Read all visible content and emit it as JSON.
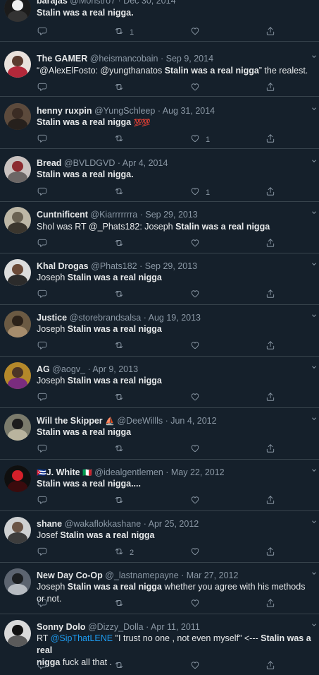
{
  "tweets": [
    {
      "name": "barajas",
      "handle": "@M0nstro7",
      "date": "Dec 30, 2014",
      "avatar_colors": [
        "#1b1b1b",
        "#f0f0f0",
        "#333"
      ],
      "text": [
        {
          "t": "Stalin was a real nigga.",
          "b": true
        }
      ],
      "counts": {
        "reply": "",
        "retweet": "1",
        "like": "",
        "share": ""
      }
    },
    {
      "name": "The GAMER",
      "handle": "@heismancobain",
      "date": "Sep 9, 2014",
      "avatar_colors": [
        "#e9e1dc",
        "#5a3a2e",
        "#b3283a"
      ],
      "text": [
        {
          "t": "“@AlexElFosto: @yungthanatos ",
          "b": false
        },
        {
          "t": "Stalin was a real nigga",
          "b": true
        },
        {
          "t": "” the realest.",
          "b": false
        }
      ],
      "counts": {
        "reply": "",
        "retweet": "",
        "like": "",
        "share": ""
      }
    },
    {
      "name": "henny ruxpin",
      "handle": "@YungSchleep",
      "date": "Aug 31, 2014",
      "avatar_colors": [
        "#5c4a3c",
        "#3b2c24",
        "#26201c"
      ],
      "text": [
        {
          "t": "Stalin was a real nigga ",
          "b": true
        }
      ],
      "emoji": "💯💯",
      "counts": {
        "reply": "",
        "retweet": "",
        "like": "1",
        "share": ""
      }
    },
    {
      "name": "Bread",
      "handle": "@BVLDGVD",
      "date": "Apr 4, 2014",
      "avatar_colors": [
        "#c9c2c0",
        "#8c2b30",
        "#6c6766"
      ],
      "text": [
        {
          "t": "Stalin was a real nigga.",
          "b": true
        }
      ],
      "counts": {
        "reply": "",
        "retweet": "",
        "like": "1",
        "share": ""
      }
    },
    {
      "name": "Cuntnificent",
      "handle": "@Kiarrrrrrra",
      "date": "Sep 29, 2013",
      "avatar_colors": [
        "#bdb7a6",
        "#6a6253",
        "#3b362e"
      ],
      "text": [
        {
          "t": "Shol was RT @_Phats182: Joseph ",
          "b": false
        },
        {
          "t": "Stalin was a real nigga",
          "b": true
        }
      ],
      "counts": {
        "reply": "",
        "retweet": "",
        "like": "",
        "share": ""
      }
    },
    {
      "name": "Khal Drogas",
      "handle": "@Phats182",
      "date": "Sep 29, 2013",
      "avatar_colors": [
        "#dcdcdc",
        "#6b4a38",
        "#2b2b2b"
      ],
      "text": [
        {
          "t": "Joseph ",
          "b": false
        },
        {
          "t": "Stalin was a real nigga",
          "b": true
        }
      ],
      "counts": {
        "reply": "",
        "retweet": "",
        "like": "",
        "share": ""
      }
    },
    {
      "name": "Justice",
      "handle": "@storebrandsalsa",
      "date": "Aug 19, 2013",
      "avatar_colors": [
        "#6b5a43",
        "#2c2219",
        "#a58c6c"
      ],
      "text": [
        {
          "t": "Joseph ",
          "b": false
        },
        {
          "t": "Stalin was a real nigga",
          "b": true
        }
      ],
      "counts": {
        "reply": "",
        "retweet": "",
        "like": "",
        "share": ""
      }
    },
    {
      "name": "AG",
      "handle": "@aogv_",
      "date": "Apr 9, 2013",
      "avatar_colors": [
        "#b4882a",
        "#4c3526",
        "#7a2c7e"
      ],
      "text": [
        {
          "t": "Joseph ",
          "b": false
        },
        {
          "t": "Stalin was a real nigga",
          "b": true
        }
      ],
      "counts": {
        "reply": "",
        "retweet": "",
        "like": "",
        "share": ""
      }
    },
    {
      "name": "Will the Skipper",
      "handle": "@DeeWillls",
      "date": "Jun 4, 2012",
      "avatar_colors": [
        "#7b7b6c",
        "#1c1c1c",
        "#b9b49e"
      ],
      "name_emoji": "⛵",
      "text": [
        {
          "t": "Stalin was a real nigga",
          "b": true
        }
      ],
      "counts": {
        "reply": "",
        "retweet": "",
        "like": "",
        "share": ""
      }
    },
    {
      "name": "J. White",
      "handle": "@idealgentlemen",
      "date": "May 22, 2012",
      "avatar_colors": [
        "#0f0f0f",
        "#d4202a",
        "#3a0b0d"
      ],
      "name_prefix": "🇨🇺",
      "name_emoji": "🇮🇹",
      "text": [
        {
          "t": "Stalin was a real nigga....",
          "b": true
        }
      ],
      "counts": {
        "reply": "",
        "retweet": "",
        "like": "",
        "share": ""
      }
    },
    {
      "name": "shane",
      "handle": "@wakaflokkashane",
      "date": "Apr 25, 2012",
      "avatar_colors": [
        "#cfd1d2",
        "#6a5446",
        "#3d3d3d"
      ],
      "text": [
        {
          "t": "Josef ",
          "b": false
        },
        {
          "t": "Stalin was a real nigga",
          "b": true
        }
      ],
      "counts": {
        "reply": "",
        "retweet": "2",
        "like": "",
        "share": ""
      }
    },
    {
      "name": "New Day Co-Op",
      "handle": "@_lastnamepayne",
      "date": "Mar 27, 2012",
      "avatar_colors": [
        "#5c6470",
        "#1c1f22",
        "#b7bcc2"
      ],
      "text": [
        {
          "t": "Joseph ",
          "b": false
        },
        {
          "t": "Stalin was a real nigga",
          "b": true
        },
        {
          "t": " whether you agree with his methods or not.",
          "b": false
        }
      ],
      "counts": {
        "reply": "",
        "retweet": "",
        "like": "",
        "share": ""
      }
    },
    {
      "name": "Sonny Dolo",
      "handle": "@Dizzy_Dolla",
      "date": "Apr 11, 2011",
      "avatar_colors": [
        "#d9d9d9",
        "#111111",
        "#5a5a5a"
      ],
      "text_line1": [
        {
          "t": "RT ",
          "b": false
        },
        {
          "t": "@SipThatLENE",
          "b": false,
          "m": true
        },
        {
          "t": " \"I trust no one , not even myself\" <--- ",
          "b": false
        },
        {
          "t": "Stalin was a real",
          "b": true
        }
      ],
      "text_line2": [
        {
          "t": "nigga",
          "b": true
        },
        {
          "t": " fuck all that .",
          "b": false
        }
      ],
      "counts": {
        "reply": "",
        "retweet": "",
        "like": "",
        "share": ""
      }
    }
  ],
  "icons": {
    "reply": "reply-icon",
    "retweet": "retweet-icon",
    "like": "heart-icon",
    "share": "share-icon",
    "more": "chevron-down-icon"
  },
  "colors": {
    "background": "#15202b",
    "text": "#e7e9ea",
    "secondary": "#8b98a5",
    "link": "#1d9bf0",
    "divider": "#38444d"
  }
}
